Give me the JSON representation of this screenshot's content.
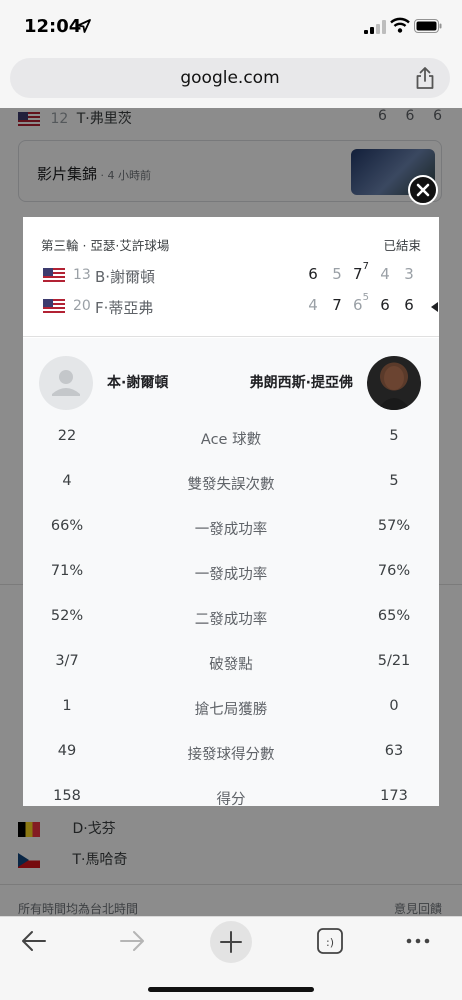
{
  "status_bar": {
    "time": "12:04"
  },
  "browser": {
    "url": "google.com"
  },
  "background_page": {
    "top_row": {
      "seed": "12",
      "name": "T·弗里茨",
      "scores": [
        "6",
        "6",
        "6"
      ]
    },
    "highlights": {
      "title": "影片集錦",
      "age": " · 4 小時前"
    },
    "other_players": [
      "D·戈芬",
      "T·馬哈奇"
    ],
    "footer_left": "所有時間均為台北時間",
    "footer_right": "意見回饋"
  },
  "match": {
    "round_venue": "第三輪 · 亞瑟·艾許球場",
    "status": "已結束",
    "players": [
      {
        "seed": "13",
        "name": "B·謝爾頓",
        "sets": [
          {
            "games": "6",
            "tb": "",
            "won": true
          },
          {
            "games": "5",
            "tb": "",
            "won": false
          },
          {
            "games": "7",
            "tb": "7",
            "won": true
          },
          {
            "games": "4",
            "tb": "",
            "won": false
          },
          {
            "games": "3",
            "tb": "",
            "won": false
          }
        ]
      },
      {
        "seed": "20",
        "name": "F·蒂亞弗",
        "sets": [
          {
            "games": "4",
            "tb": "",
            "won": false
          },
          {
            "games": "7",
            "tb": "",
            "won": true
          },
          {
            "games": "6",
            "tb": "5",
            "won": false
          },
          {
            "games": "6",
            "tb": "",
            "won": true
          },
          {
            "games": "6",
            "tb": "",
            "won": true
          }
        ]
      }
    ],
    "stats_header": {
      "left_name": "本·謝爾頓",
      "right_name": "弗朗西斯·提亞佛"
    },
    "stats": [
      {
        "left": "22",
        "label": "Ace 球數",
        "right": "5"
      },
      {
        "left": "4",
        "label": "雙發失誤次數",
        "right": "5"
      },
      {
        "left": "66%",
        "label": "一發成功率",
        "right": "57%"
      },
      {
        "left": "71%",
        "label": "一發成功率",
        "right": "76%"
      },
      {
        "left": "52%",
        "label": "二發成功率",
        "right": "65%"
      },
      {
        "left": "3/7",
        "label": "破發點",
        "right": "5/21"
      },
      {
        "left": "1",
        "label": "搶七局獲勝",
        "right": "0"
      },
      {
        "left": "49",
        "label": "接發球得分數",
        "right": "63"
      },
      {
        "left": "158",
        "label": "得分",
        "right": "173"
      }
    ]
  },
  "toolbar": {
    "tabs_icon_text": ":)"
  }
}
